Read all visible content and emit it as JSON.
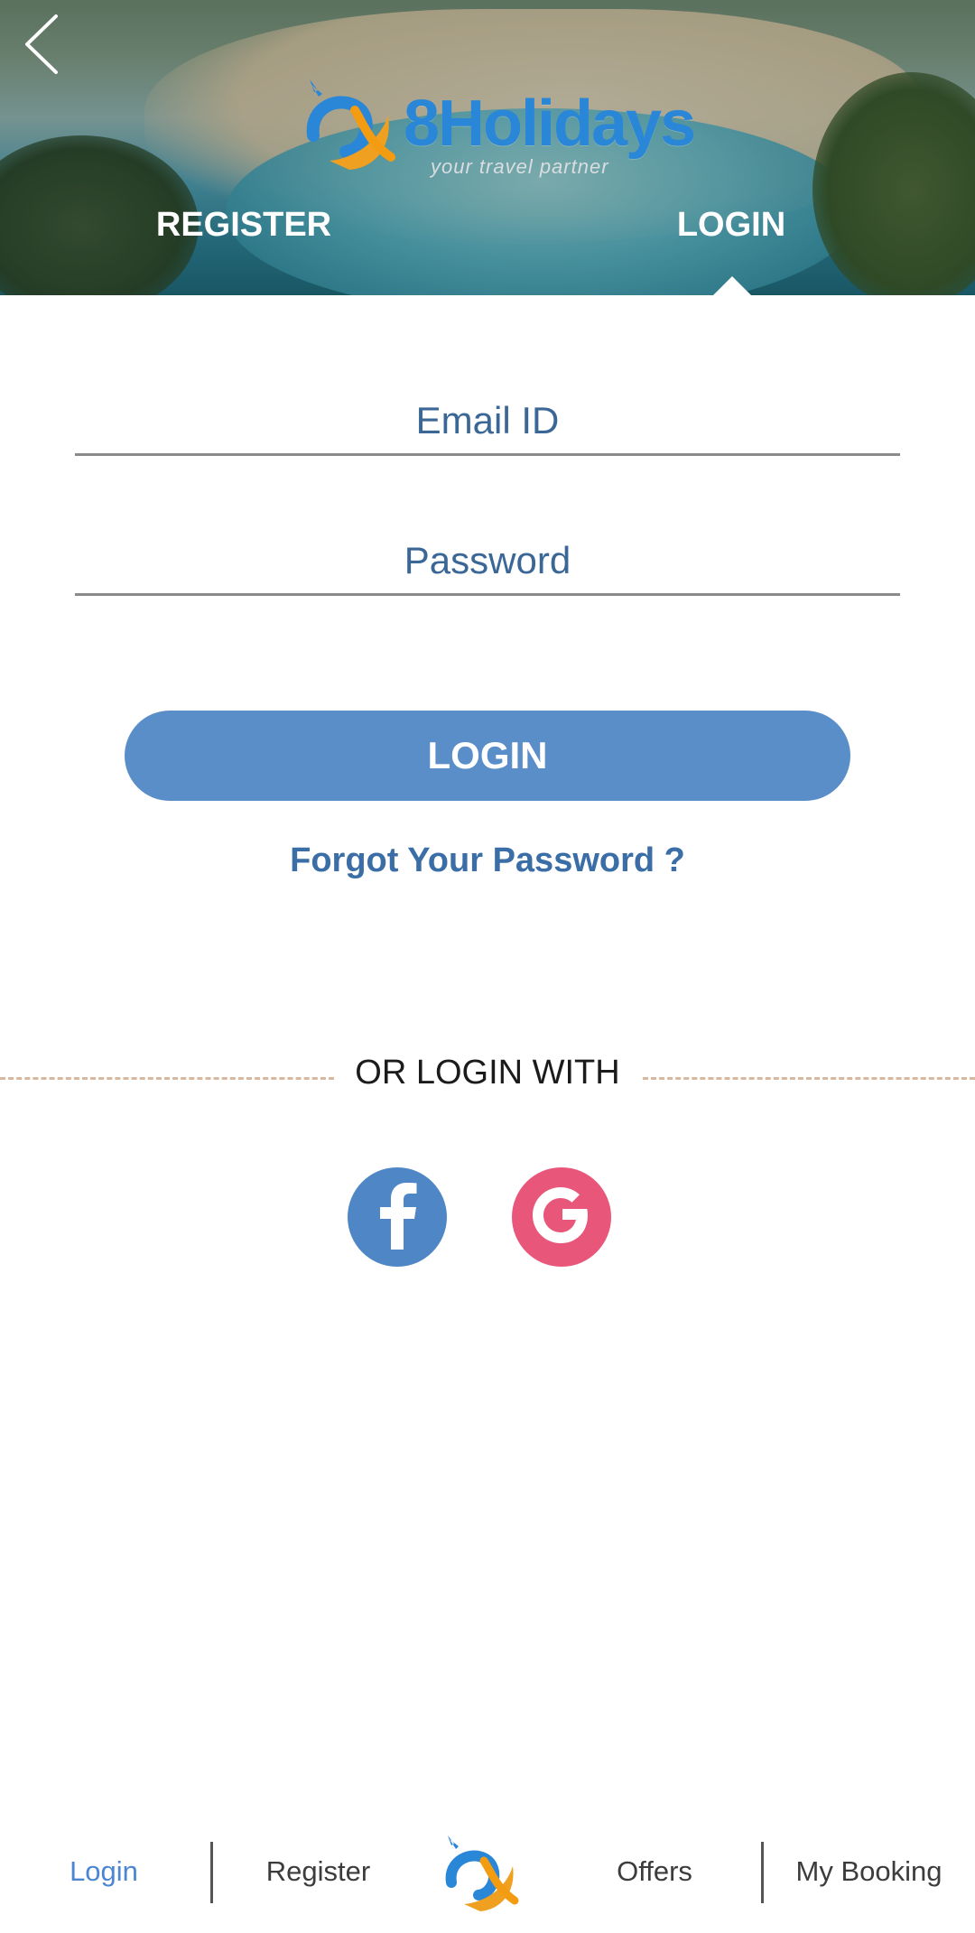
{
  "header": {
    "logo_text": "8Holidays",
    "logo_tagline": "your travel partner",
    "tabs": [
      {
        "label": "REGISTER",
        "active": false
      },
      {
        "label": "LOGIN",
        "active": true
      }
    ]
  },
  "form": {
    "email_placeholder": "Email ID",
    "email_value": "",
    "password_placeholder": "Password",
    "password_value": "",
    "login_label": "LOGIN",
    "forgot_label": "Forgot Your Password ?"
  },
  "social": {
    "divider_label": "OR LOGIN WITH",
    "providers": [
      "facebook-icon",
      "google-icon"
    ]
  },
  "bottom_nav": {
    "items": [
      {
        "label": "Login",
        "active": true
      },
      {
        "label": "Register",
        "active": false
      },
      {
        "label": "Offers",
        "active": false
      },
      {
        "label": "My Booking",
        "active": false
      }
    ]
  },
  "colors": {
    "primary": "#5a8ec9",
    "link": "#3b6ea6",
    "facebook": "#4f86c6",
    "google": "#e8577a",
    "active_nav": "#4a86d2"
  }
}
